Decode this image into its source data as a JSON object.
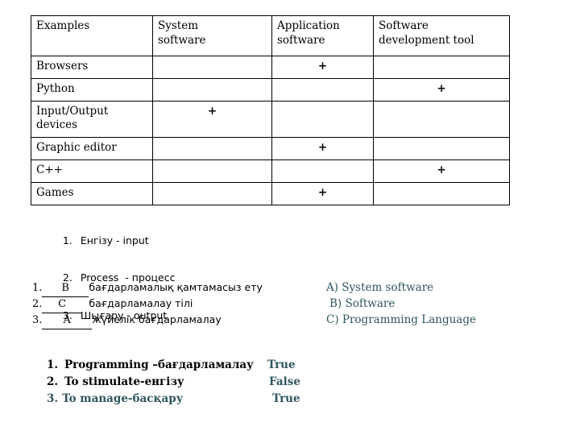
{
  "colors": {
    "teal": "#2e5561",
    "black": "#000000",
    "border": "#000000",
    "background": "#ffffff"
  },
  "table": {
    "headers": [
      "Examples",
      "System\nsoftware",
      "Application\nsoftware",
      "Software\ndevelopment tool"
    ],
    "mark": "+",
    "rows": [
      {
        "example": "Browsers",
        "system": "",
        "application": "+",
        "devtool": ""
      },
      {
        "example": "Python",
        "system": "",
        "application": "",
        "devtool": "+"
      },
      {
        "example": "Input/Output\ndevices",
        "system": "+",
        "application": "",
        "devtool": ""
      },
      {
        "example": "Graphic editor",
        "system": "",
        "application": "+",
        "devtool": ""
      },
      {
        "example": "C++",
        "system": "",
        "application": "",
        "devtool": "+"
      },
      {
        "example": "Games",
        "system": "",
        "application": "+",
        "devtool": ""
      }
    ]
  },
  "glossary": {
    "items": [
      {
        "num": "1.",
        "text": "Енгізу - input"
      },
      {
        "num": "2.",
        "text": "Process  - процесс"
      },
      {
        "num": "3.",
        "text": "Шығару - output"
      }
    ]
  },
  "matching": {
    "rows": [
      {
        "num": "1.",
        "answer": "B",
        "term": "бағдарламалық қамтамасыз ету",
        "option": "A) System software"
      },
      {
        "num": "2.",
        "answer": "C",
        "term": "бағдарламалау тілі",
        "option": "B) Software"
      },
      {
        "num": "3.",
        "answer": "A",
        "term": "жүйелік бағдарламалау",
        "option": "C) Programming Language"
      }
    ]
  },
  "truefalse": {
    "rows": [
      {
        "num": "1.",
        "statement": "Programming –бағдарламалау",
        "value": "True",
        "statement_color": "#000000",
        "value_color": "#2e5561",
        "indent": true
      },
      {
        "num": "2.",
        "statement": "To stimulate-енгізу",
        "value": "False",
        "statement_color": "#000000",
        "value_color": "#2e5561",
        "indent": true
      },
      {
        "num": "3.",
        "statement": "To manage-басқару",
        "value": "True",
        "statement_color": "#2e5561",
        "value_color": "#2e5561",
        "indent": false
      }
    ]
  }
}
